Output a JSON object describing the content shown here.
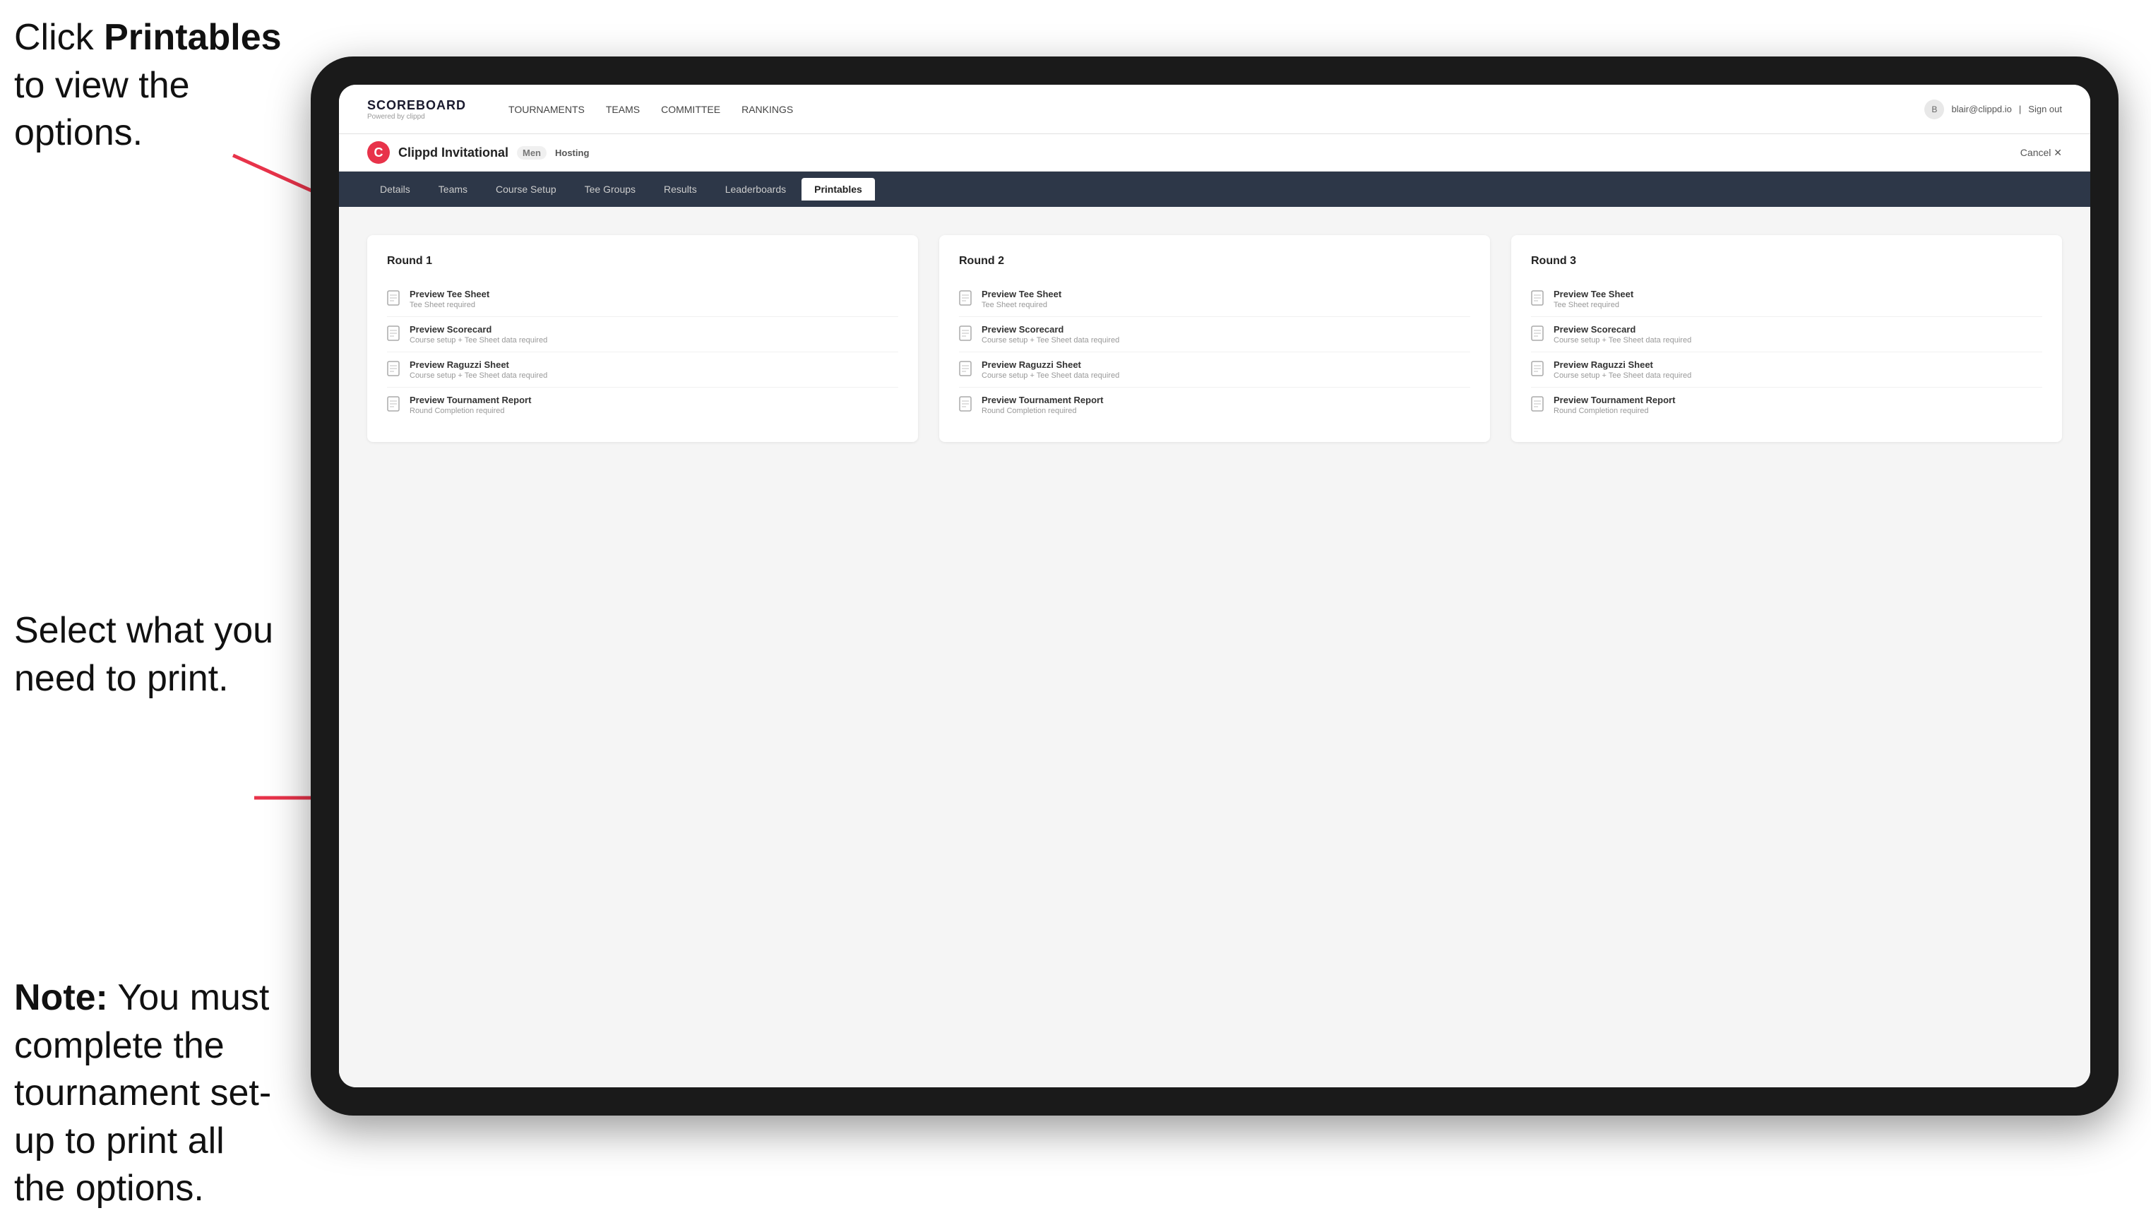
{
  "annotations": {
    "top": {
      "text_before": "Click ",
      "bold": "Printables",
      "text_after": " to view the options."
    },
    "middle": {
      "text": "Select what you need to print."
    },
    "bottom": {
      "bold": "Note:",
      "text_after": " You must complete the tournament set-up to print all the options."
    }
  },
  "top_nav": {
    "logo_title": "SCOREBOARD",
    "logo_sub": "Powered by clippd",
    "links": [
      {
        "label": "TOURNAMENTS",
        "active": false
      },
      {
        "label": "TEAMS",
        "active": false
      },
      {
        "label": "COMMITTEE",
        "active": false
      },
      {
        "label": "RANKINGS",
        "active": false
      }
    ],
    "user_email": "blair@clippd.io",
    "sign_out": "Sign out"
  },
  "tournament_header": {
    "name": "Clippd Invitational",
    "badge": "Men",
    "status": "Hosting",
    "cancel": "Cancel ✕"
  },
  "tabs": [
    {
      "label": "Details",
      "active": false
    },
    {
      "label": "Teams",
      "active": false
    },
    {
      "label": "Course Setup",
      "active": false
    },
    {
      "label": "Tee Groups",
      "active": false
    },
    {
      "label": "Results",
      "active": false
    },
    {
      "label": "Leaderboards",
      "active": false
    },
    {
      "label": "Printables",
      "active": true
    }
  ],
  "rounds": [
    {
      "title": "Round 1",
      "items": [
        {
          "title": "Preview Tee Sheet",
          "sub": "Tee Sheet required"
        },
        {
          "title": "Preview Scorecard",
          "sub": "Course setup + Tee Sheet data required"
        },
        {
          "title": "Preview Raguzzi Sheet",
          "sub": "Course setup + Tee Sheet data required"
        },
        {
          "title": "Preview Tournament Report",
          "sub": "Round Completion required"
        }
      ]
    },
    {
      "title": "Round 2",
      "items": [
        {
          "title": "Preview Tee Sheet",
          "sub": "Tee Sheet required"
        },
        {
          "title": "Preview Scorecard",
          "sub": "Course setup + Tee Sheet data required"
        },
        {
          "title": "Preview Raguzzi Sheet",
          "sub": "Course setup + Tee Sheet data required"
        },
        {
          "title": "Preview Tournament Report",
          "sub": "Round Completion required"
        }
      ]
    },
    {
      "title": "Round 3",
      "items": [
        {
          "title": "Preview Tee Sheet",
          "sub": "Tee Sheet required"
        },
        {
          "title": "Preview Scorecard",
          "sub": "Course setup + Tee Sheet data required"
        },
        {
          "title": "Preview Raguzzi Sheet",
          "sub": "Course setup + Tee Sheet data required"
        },
        {
          "title": "Preview Tournament Report",
          "sub": "Round Completion required"
        }
      ]
    }
  ],
  "colors": {
    "accent": "#e8334a",
    "nav_bg": "#2d3748",
    "arrow": "#e8334a"
  }
}
